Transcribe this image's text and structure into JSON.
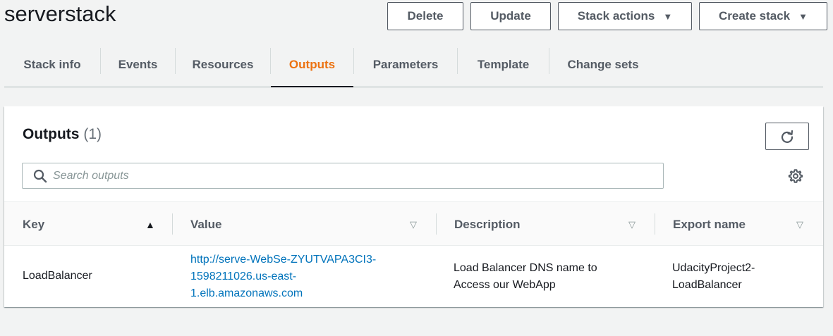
{
  "header": {
    "title": "serverstack",
    "buttons": {
      "delete": "Delete",
      "update": "Update",
      "stack_actions": "Stack actions",
      "create_stack": "Create stack"
    }
  },
  "tabs": [
    {
      "label": "Stack info",
      "active": false
    },
    {
      "label": "Events",
      "active": false
    },
    {
      "label": "Resources",
      "active": false
    },
    {
      "label": "Outputs",
      "active": true
    },
    {
      "label": "Parameters",
      "active": false
    },
    {
      "label": "Template",
      "active": false
    },
    {
      "label": "Change sets",
      "active": false
    }
  ],
  "outputs": {
    "title": "Outputs",
    "count": "(1)",
    "search": {
      "placeholder": "Search outputs",
      "value": ""
    },
    "columns": [
      "Key",
      "Value",
      "Description",
      "Export name"
    ],
    "rows": [
      {
        "key": "LoadBalancer",
        "value_lines": [
          "http://serve-WebSe-ZYUTVAPA3CI3-",
          "1598211026.us-east-",
          "1.elb.amazonaws.com"
        ],
        "description_lines": [
          "Load Balancer DNS name to",
          "Access our WebApp"
        ],
        "export_lines": [
          "UdacityProject2-",
          "LoadBalancer"
        ]
      }
    ]
  },
  "icons": {
    "caret": "caret-down-icon",
    "refresh": "refresh-icon",
    "search": "search-icon",
    "settings": "gear-icon",
    "sort_asc": "sort-ascending-icon",
    "sort_none": "sort-icon"
  },
  "colors": {
    "accent": "#ec7211",
    "link": "#0073bb",
    "text": "#16191f",
    "muted": "#545b64"
  }
}
